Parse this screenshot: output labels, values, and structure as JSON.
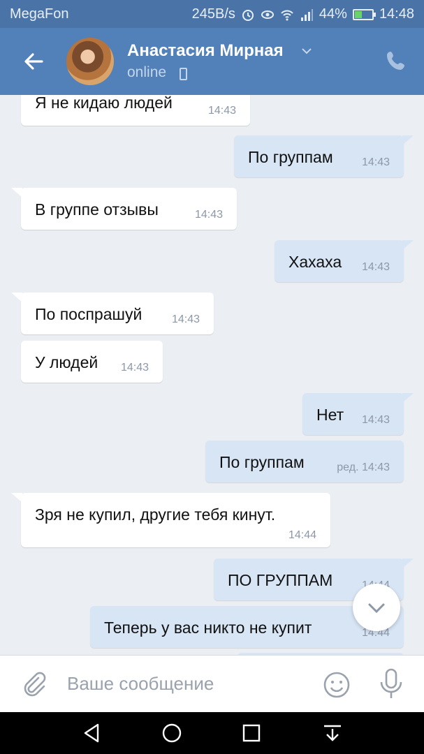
{
  "status_bar": {
    "carrier": "MegaFon",
    "speed": "245B/s",
    "battery": "44%",
    "battery_level": 0.44,
    "time": "14:48",
    "icons": [
      "alarm-icon",
      "eye-icon",
      "wifi-icon",
      "signal-icon",
      "battery-icon"
    ]
  },
  "header": {
    "contact_name": "Анастасия Мирная",
    "status": "online",
    "icons": [
      "back-arrow-icon",
      "chevron-down-icon",
      "mobile-device-icon",
      "phone-call-icon"
    ]
  },
  "messages": [
    {
      "direction": "in",
      "text": "Я не кидаю людей",
      "time": "14:43"
    },
    {
      "direction": "out",
      "text": "По группам",
      "time": "14:43"
    },
    {
      "direction": "in",
      "text": "В группе отзывы",
      "time": "14:43"
    },
    {
      "direction": "out",
      "text": "Хахаха",
      "time": "14:43"
    },
    {
      "direction": "in",
      "text": "По поспрашуй",
      "time": "14:43"
    },
    {
      "direction": "in",
      "text": "У людей",
      "time": "14:43"
    },
    {
      "direction": "out",
      "text": "Нет",
      "time": "14:43"
    },
    {
      "direction": "out",
      "text": "По группам",
      "time": "ред. 14:43"
    },
    {
      "direction": "in",
      "text": "Зря не купил, другие тебя кинут.",
      "time": "14:44"
    },
    {
      "direction": "out",
      "text": "ПО ГРУППАМ",
      "time": "14:44"
    },
    {
      "direction": "out",
      "text": "Теперь у вас никто не купит",
      "time": "14:44"
    }
  ],
  "composer": {
    "placeholder": "Ваше сообщение",
    "icons": [
      "attach-icon",
      "emoji-icon",
      "microphone-icon"
    ]
  },
  "navigation": {
    "icons": [
      "nav-back-icon",
      "nav-home-icon",
      "nav-recents-icon",
      "nav-notifications-icon"
    ]
  },
  "colors": {
    "header": "#5181b8",
    "status_bar": "#4a74a8",
    "background": "#ebeef2",
    "incoming_bubble": "#ffffff",
    "outgoing_bubble": "#d8e5f5"
  }
}
